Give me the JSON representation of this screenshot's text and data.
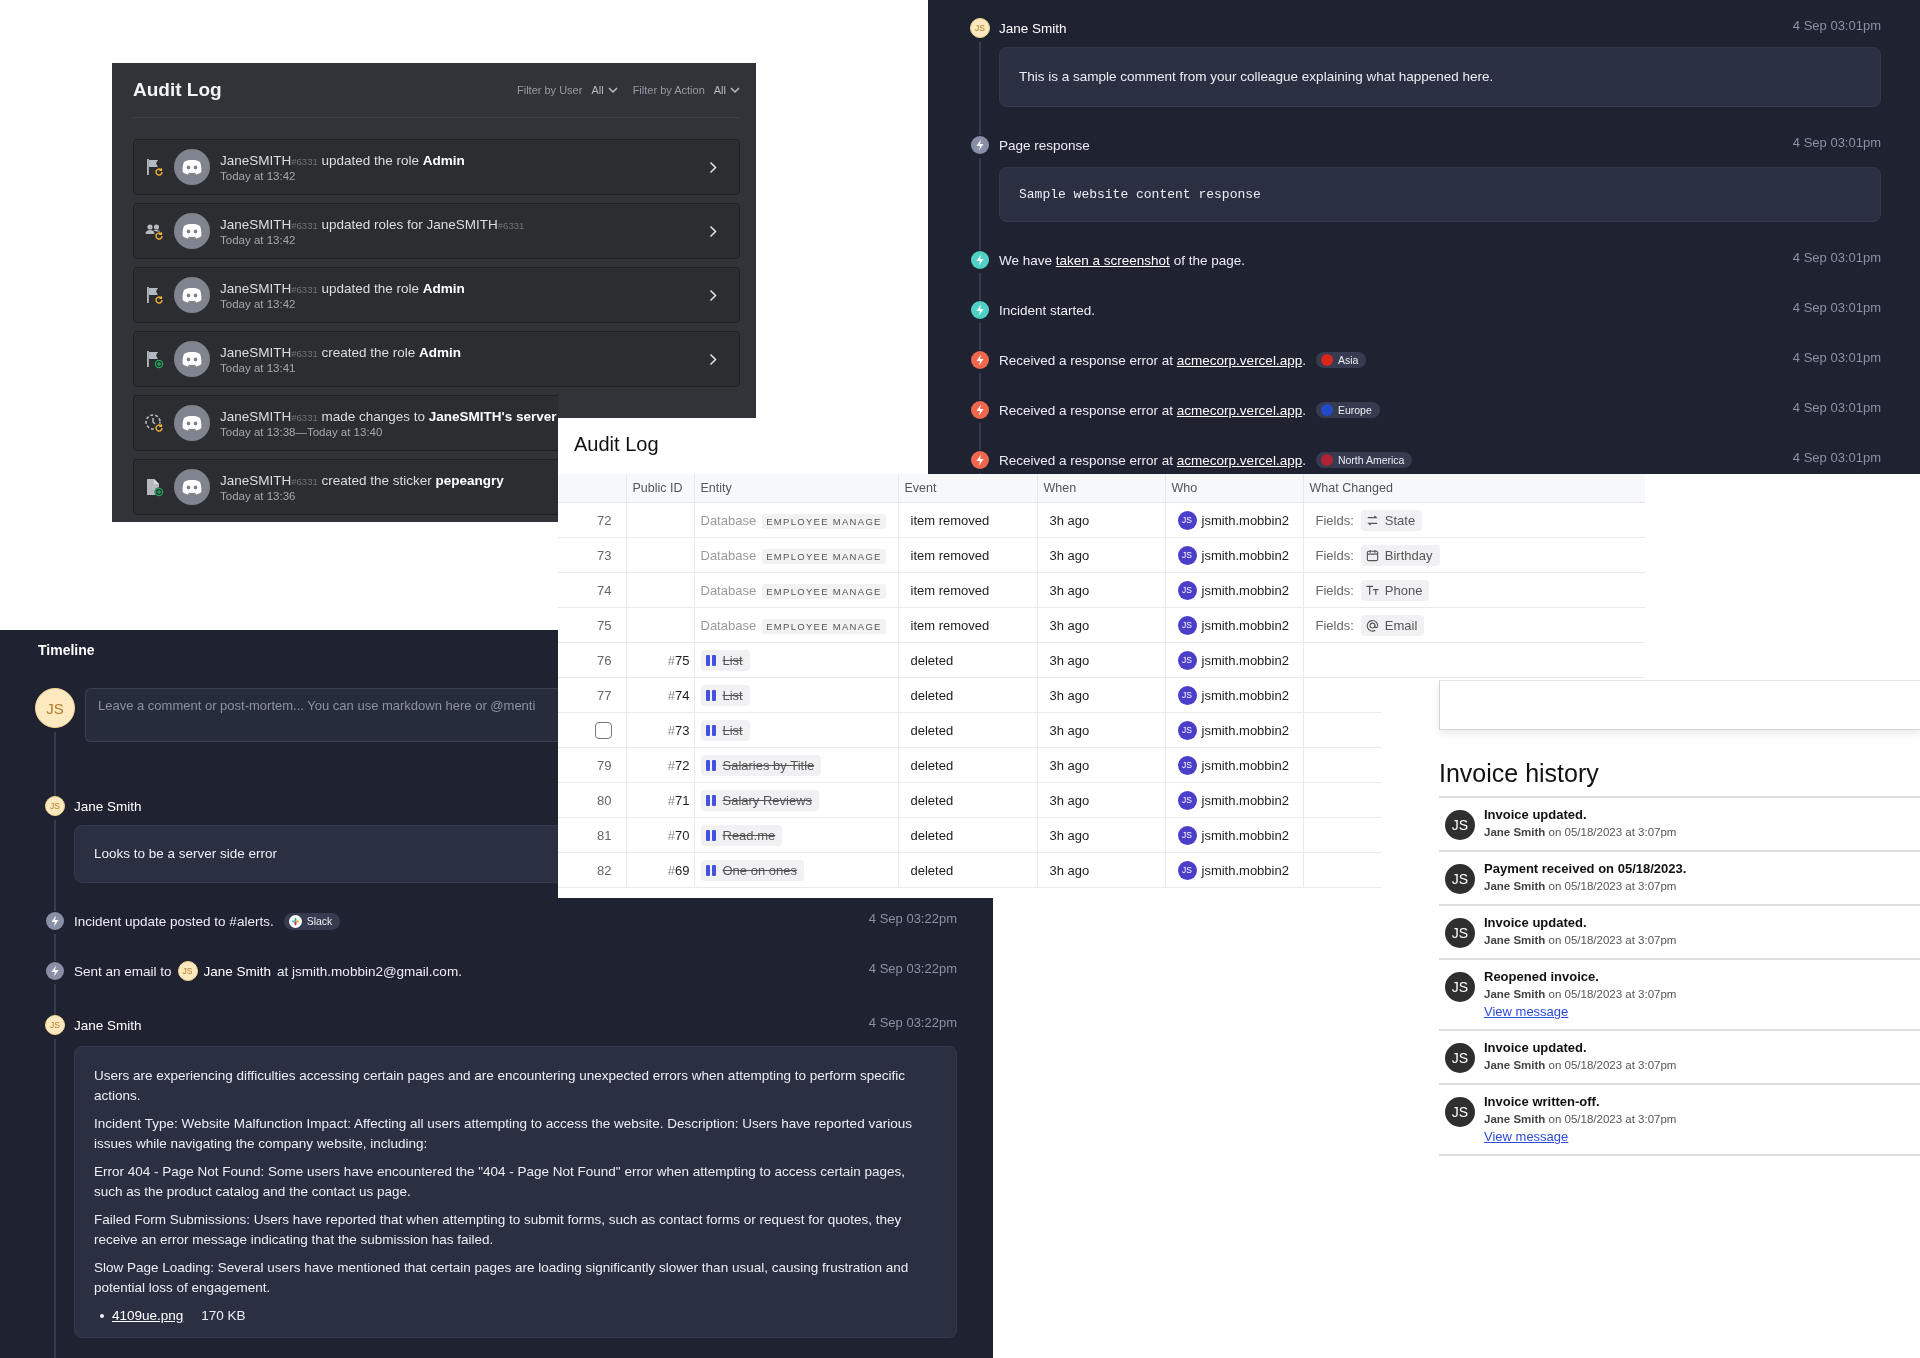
{
  "audit_log_dark": {
    "title": "Audit Log",
    "filters": [
      {
        "label": "Filter by User",
        "value": "All"
      },
      {
        "label": "Filter by Action",
        "value": "All"
      }
    ],
    "entries": [
      {
        "kind": "role_update",
        "user": "JaneSMITH",
        "tag": "#6331",
        "action": "updated the role",
        "target": "Admin",
        "time": "Today at 13:42",
        "chevron": true
      },
      {
        "kind": "member_role_update",
        "user": "JaneSMITH",
        "tag": "#6331",
        "action": "updated roles for",
        "target_user": "JaneSMITH",
        "target_tag": "#6331",
        "time": "Today at 13:42",
        "chevron": true
      },
      {
        "kind": "role_update",
        "user": "JaneSMITH",
        "tag": "#6331",
        "action": "updated the role",
        "target": "Admin",
        "time": "Today at 13:42",
        "chevron": true
      },
      {
        "kind": "role_create",
        "user": "JaneSMITH",
        "tag": "#6331",
        "action": "created the role",
        "target": "Admin",
        "time": "Today at 13:41",
        "chevron": true
      },
      {
        "kind": "server_update",
        "user": "JaneSMITH",
        "tag": "#6331",
        "action": "made changes to",
        "target": "JaneSMITH's server",
        "time": "Today at 13:38—Today at 13:40",
        "chevron": false
      },
      {
        "kind": "sticker_create",
        "user": "JaneSMITH",
        "tag": "#6331",
        "action": "created the sticker",
        "target": "pepeangry",
        "time": "Today at 13:36",
        "chevron": false
      }
    ]
  },
  "incident_timeline": {
    "events": [
      {
        "kind": "comment",
        "initials": "JS",
        "author": "Jane Smith",
        "time": "4 Sep 03:01pm",
        "paragraphs": [
          "This is a sample comment from your colleague explaining what happened here."
        ]
      },
      {
        "kind": "response",
        "text": "Page response",
        "time": "4 Sep 03:01pm",
        "code": "Sample website content response"
      },
      {
        "kind": "info",
        "text": "We have ",
        "link": "taken a screenshot",
        "text_after": " of the page.",
        "time": "4 Sep 03:01pm"
      },
      {
        "kind": "info",
        "text": "Incident started.",
        "time": "4 Sep 03:01pm"
      },
      {
        "kind": "error",
        "text": "Received a response error at ",
        "link": "acmecorp.vercel.app",
        "text_after": ".",
        "region": {
          "label": "Asia",
          "color": "#da251d"
        },
        "time": "4 Sep 03:01pm"
      },
      {
        "kind": "error",
        "text": "Received a response error at ",
        "link": "acmecorp.vercel.app",
        "text_after": ".",
        "region": {
          "label": "Europe",
          "color": "#2149c9"
        },
        "time": "4 Sep 03:01pm"
      },
      {
        "kind": "error",
        "text": "Received a response error at ",
        "link": "acmecorp.vercel.app",
        "text_after": ".",
        "region": {
          "label": "North America",
          "color": "#b22234"
        },
        "time": "4 Sep 03:01pm"
      }
    ]
  },
  "table": {
    "title": "Audit Log",
    "columns": [
      "Public ID",
      "Entity",
      "Event",
      "When",
      "Who",
      "What Changed"
    ],
    "rows": [
      {
        "kind": "number",
        "number": "72",
        "entity": {
          "kind": "database",
          "label": "Database",
          "tag": "EMPLOYEE MANAGE"
        },
        "event": "item removed",
        "when": "3h ago",
        "who": {
          "initials": "JS",
          "name": "jsmith.mobbin2"
        },
        "changed": {
          "label": "Fields:",
          "field": {
            "kind": "select",
            "name": "State"
          }
        }
      },
      {
        "kind": "number",
        "number": "73",
        "entity": {
          "kind": "database",
          "label": "Database",
          "tag": "EMPLOYEE MANAGE"
        },
        "event": "item removed",
        "when": "3h ago",
        "who": {
          "initials": "JS",
          "name": "jsmith.mobbin2"
        },
        "changed": {
          "label": "Fields:",
          "field": {
            "kind": "date",
            "name": "Birthday"
          }
        }
      },
      {
        "kind": "number",
        "number": "74",
        "entity": {
          "kind": "database",
          "label": "Database",
          "tag": "EMPLOYEE MANAGE"
        },
        "event": "item removed",
        "when": "3h ago",
        "who": {
          "initials": "JS",
          "name": "jsmith.mobbin2"
        },
        "changed": {
          "label": "Fields:",
          "field": {
            "kind": "text",
            "name": "Phone"
          }
        }
      },
      {
        "kind": "number",
        "number": "75",
        "entity": {
          "kind": "database",
          "label": "Database",
          "tag": "EMPLOYEE MANAGE"
        },
        "event": "item removed",
        "when": "3h ago",
        "who": {
          "initials": "JS",
          "name": "jsmith.mobbin2"
        },
        "changed": {
          "label": "Fields:",
          "field": {
            "kind": "email",
            "name": "Email"
          }
        }
      },
      {
        "kind": "number",
        "number": "76",
        "public_id": {
          "hash": "#",
          "value": "75"
        },
        "entity": {
          "kind": "page",
          "label": "List"
        },
        "event": "deleted",
        "when": "3h ago",
        "who": {
          "initials": "JS",
          "name": "jsmith.mobbin2"
        }
      },
      {
        "kind": "number",
        "number": "77",
        "public_id": {
          "hash": "#",
          "value": "74"
        },
        "entity": {
          "kind": "page",
          "label": "List"
        },
        "event": "deleted",
        "when": "3h ago",
        "who": {
          "initials": "JS",
          "name": "jsmith.mobbin2"
        }
      },
      {
        "kind": "checkbox",
        "checked": false,
        "public_id": {
          "hash": "#",
          "value": "73"
        },
        "entity": {
          "kind": "page",
          "label": "List"
        },
        "event": "deleted",
        "when": "3h ago",
        "who": {
          "initials": "JS",
          "name": "jsmith.mobbin2"
        }
      },
      {
        "kind": "number",
        "number": "79",
        "public_id": {
          "hash": "#",
          "value": "72"
        },
        "entity": {
          "kind": "page",
          "label": "Salaries by Title"
        },
        "event": "deleted",
        "when": "3h ago",
        "who": {
          "initials": "JS",
          "name": "jsmith.mobbin2"
        }
      },
      {
        "kind": "number",
        "number": "80",
        "public_id": {
          "hash": "#",
          "value": "71"
        },
        "entity": {
          "kind": "page",
          "label": "Salary Reviews"
        },
        "event": "deleted",
        "when": "3h ago",
        "who": {
          "initials": "JS",
          "name": "jsmith.mobbin2"
        }
      },
      {
        "kind": "number",
        "number": "81",
        "public_id": {
          "hash": "#",
          "value": "70"
        },
        "entity": {
          "kind": "page",
          "label": "Read.me"
        },
        "event": "deleted",
        "when": "3h ago",
        "who": {
          "initials": "JS",
          "name": "jsmith.mobbin2"
        }
      },
      {
        "kind": "number",
        "number": "82",
        "public_id": {
          "hash": "#",
          "value": "69"
        },
        "entity": {
          "kind": "page",
          "label": "One on ones"
        },
        "event": "deleted",
        "when": "3h ago",
        "who": {
          "initials": "JS",
          "name": "jsmith.mobbin2"
        }
      }
    ]
  },
  "timeline": {
    "title": "Timeline",
    "composer": {
      "initials": "JS",
      "placeholder": "Leave a comment or post-mortem... You can use markdown here or @menti"
    },
    "events": [
      {
        "kind": "comment",
        "initials": "JS",
        "author": "Jane Smith",
        "paragraphs": [
          "Looks to be a server side error"
        ]
      },
      {
        "kind": "system",
        "text": "Incident update posted to #alerts.",
        "chip": {
          "label": "Slack"
        },
        "time": "4 Sep 03:22pm"
      },
      {
        "kind": "email",
        "text": "Sent an email to",
        "person": {
          "initials": "JS",
          "name": "Jane Smith"
        },
        "text_after": "at jsmith.mobbin2@gmail.com.",
        "time": "4 Sep 03:22pm"
      },
      {
        "kind": "comment",
        "initials": "JS",
        "author": "Jane Smith",
        "time": "4 Sep 03:22pm",
        "paragraphs": [
          "Users are experiencing difficulties accessing certain pages and are encountering unexpected errors when attempting to perform specific actions.",
          "Incident Type: Website Malfunction Impact: Affecting all users attempting to access the website. Description: Users have reported various issues while navigating the company website, including:",
          "Error 404 - Page Not Found: Some users have encountered the \"404 - Page Not Found\" error when attempting to access certain pages, such as the product catalog and the contact us page.",
          "Failed Form Submissions: Users have reported that when attempting to submit forms, such as contact forms or request for quotes, they receive an error message indicating that the submission has failed.",
          "Slow Page Loading: Several users have mentioned that certain pages are loading significantly slower than usual, causing frustration and potential loss of engagement."
        ],
        "attachment": {
          "name": "4109ue.png",
          "size": "170 KB"
        }
      }
    ]
  },
  "invoice_history": {
    "title": "Invoice history",
    "entries": [
      {
        "initials": "JS",
        "title": "Invoice updated.",
        "author": "Jane Smith",
        "meta": "on 05/18/2023 at 3:07pm"
      },
      {
        "initials": "JS",
        "title": "Payment received on 05/18/2023.",
        "author": "Jane Smith",
        "meta": "on 05/18/2023 at 3:07pm"
      },
      {
        "initials": "JS",
        "title": "Invoice updated.",
        "author": "Jane Smith",
        "meta": "on 05/18/2023 at 3:07pm"
      },
      {
        "initials": "JS",
        "title": "Reopened invoice.",
        "author": "Jane Smith",
        "meta": "on 05/18/2023 at 3:07pm",
        "link": "View message"
      },
      {
        "initials": "JS",
        "title": "Invoice updated.",
        "author": "Jane Smith",
        "meta": "on 05/18/2023 at 3:07pm"
      },
      {
        "initials": "JS",
        "title": "Invoice written-off.",
        "author": "Jane Smith",
        "meta": "on 05/18/2023 at 3:07pm",
        "link": "View message"
      }
    ]
  }
}
